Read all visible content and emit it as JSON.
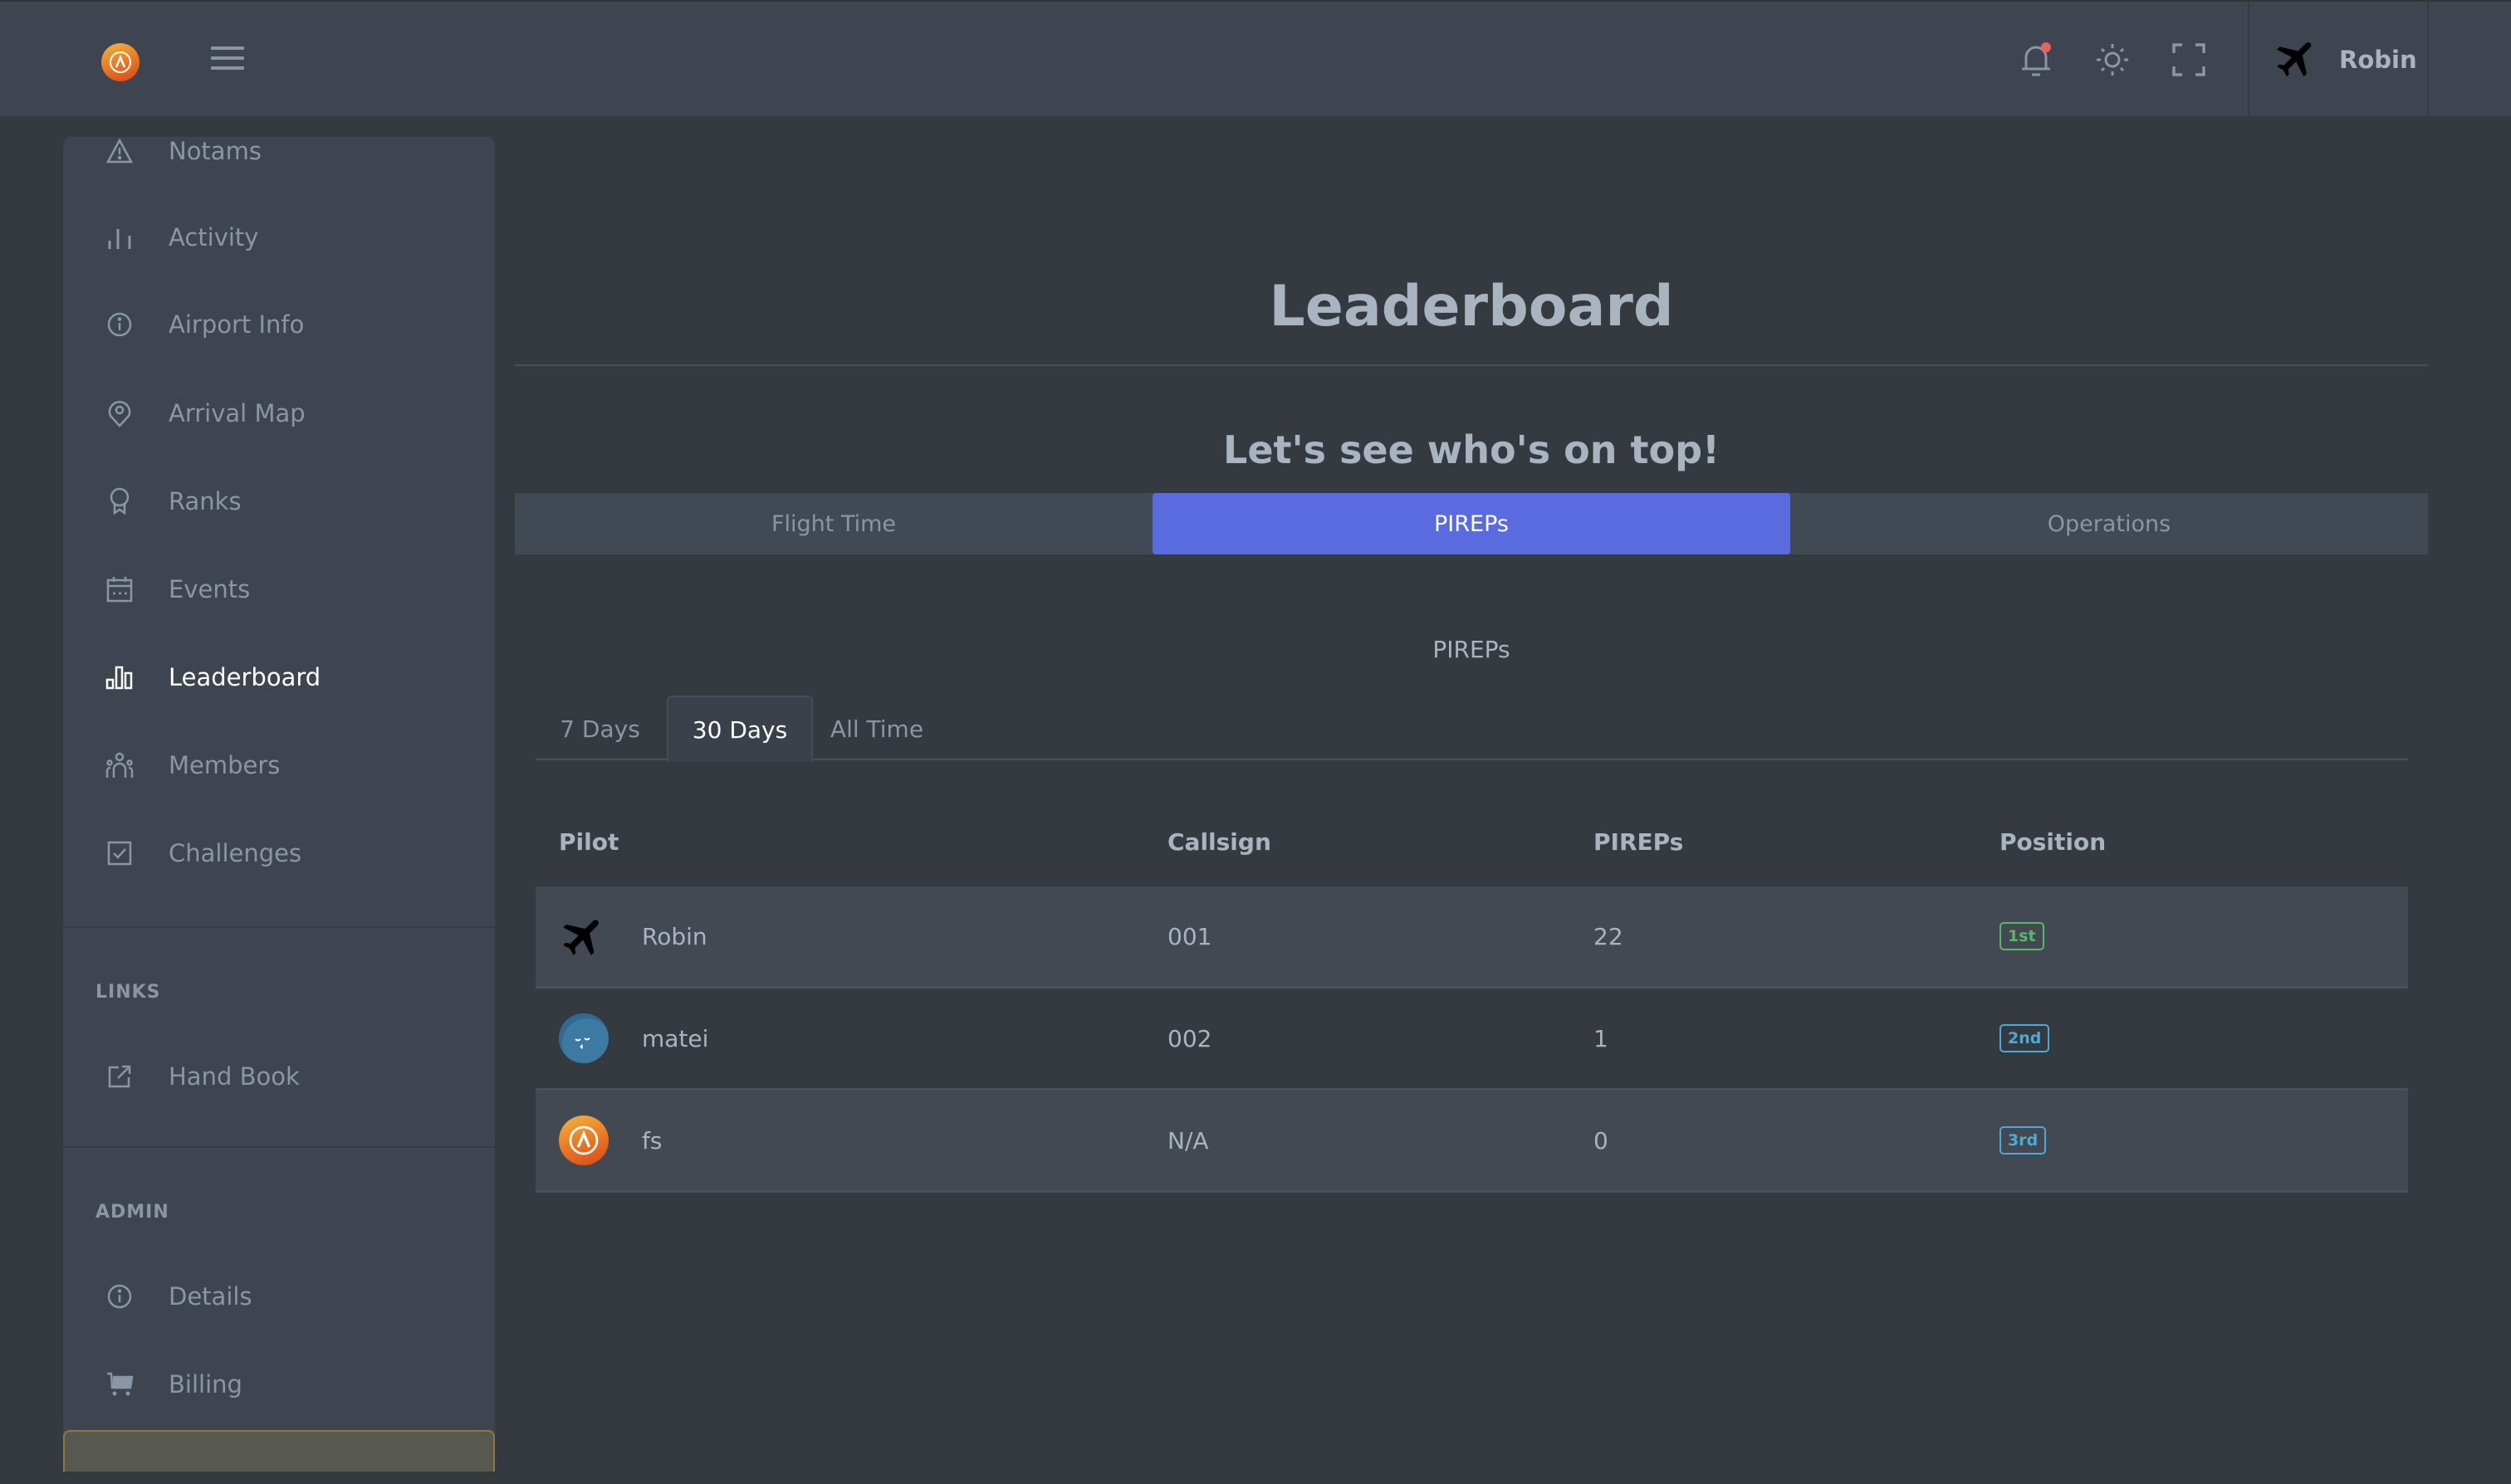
{
  "colors": {
    "accent": "#5a6bdf",
    "notification_dot": "#e8625e",
    "badge_first": "#55b96a",
    "badge_other": "#4fa9d6",
    "topbar_bg": "#3e4550",
    "page_bg": "#343a40"
  },
  "header": {
    "logo_icon": "brand-logo-icon",
    "menu_icon": "hamburger-icon",
    "icons": [
      "bell-icon",
      "sun-icon",
      "fullscreen-icon"
    ],
    "notification_dot": true,
    "user": {
      "name": "Robin",
      "avatar_icon": "airplane-icon"
    }
  },
  "sidebar": {
    "items": [
      {
        "label": "Notams",
        "icon": "warning-icon"
      },
      {
        "label": "Activity",
        "icon": "bar-chart-icon"
      },
      {
        "label": "Airport Info",
        "icon": "info-icon"
      },
      {
        "label": "Arrival Map",
        "icon": "map-pin-icon"
      },
      {
        "label": "Ranks",
        "icon": "award-icon"
      },
      {
        "label": "Events",
        "icon": "calendar-icon"
      },
      {
        "label": "Leaderboard",
        "icon": "leaderboard-icon",
        "active": true
      },
      {
        "label": "Members",
        "icon": "users-icon"
      },
      {
        "label": "Challenges",
        "icon": "checkbox-icon"
      }
    ],
    "links_section": {
      "title": "LINKS",
      "items": [
        {
          "label": "Hand Book",
          "icon": "external-link-icon"
        }
      ]
    },
    "admin_section": {
      "title": "ADMIN",
      "items": [
        {
          "label": "Details",
          "icon": "info-icon"
        },
        {
          "label": "Billing",
          "icon": "cart-icon"
        }
      ]
    }
  },
  "main": {
    "title": "Leaderboard",
    "subtitle": "Let's see who's on top!",
    "category_tabs": [
      {
        "label": "Flight Time"
      },
      {
        "label": "PIREPs",
        "active": true
      },
      {
        "label": "Operations"
      }
    ],
    "section_heading": "PIREPs",
    "period_tabs": [
      {
        "label": "7 Days"
      },
      {
        "label": "30 Days",
        "active": true
      },
      {
        "label": "All Time"
      }
    ],
    "table": {
      "columns": [
        "Pilot",
        "Callsign",
        "PIREPs",
        "Position"
      ],
      "rows": [
        {
          "pilot": "Robin",
          "avatar": "airplane-avatar",
          "callsign": "001",
          "pireps": "22",
          "position": "1st"
        },
        {
          "pilot": "matei",
          "avatar": "blue-face-avatar",
          "callsign": "002",
          "pireps": "1",
          "position": "2nd"
        },
        {
          "pilot": "fs",
          "avatar": "brand-logo-avatar",
          "callsign": "N/A",
          "pireps": "0",
          "position": "3rd"
        }
      ]
    }
  }
}
